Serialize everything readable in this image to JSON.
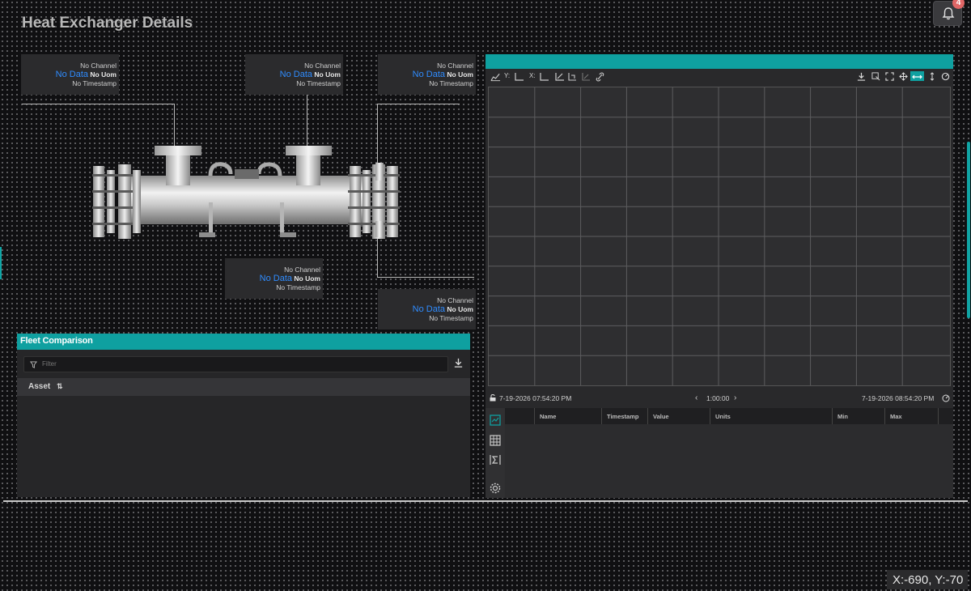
{
  "page": {
    "title": "Heat Exchanger Details"
  },
  "notifications": {
    "count": "4",
    "icon": "bell-icon"
  },
  "readouts": [
    {
      "channel": "No Channel",
      "value": "No Data",
      "uom": "No Uom",
      "timestamp": "No Timestamp"
    },
    {
      "channel": "No Channel",
      "value": "No Data",
      "uom": "No Uom",
      "timestamp": "No Timestamp"
    },
    {
      "channel": "No Channel",
      "value": "No Data",
      "uom": "No Uom",
      "timestamp": "No Timestamp"
    },
    {
      "channel": "No Channel",
      "value": "No Data",
      "uom": "No Uom",
      "timestamp": "No Timestamp"
    },
    {
      "channel": "No Channel",
      "value": "No Data",
      "uom": "No Uom",
      "timestamp": "No Timestamp"
    }
  ],
  "fleet": {
    "title": "Fleet Comparison",
    "filter_placeholder": "Filter",
    "column_asset": "Asset"
  },
  "trend": {
    "toolbar": {
      "y_label": "Y:",
      "x_label": "X:"
    },
    "time": {
      "start": "7-19-2026 07:54:20 PM",
      "window": "1:00:00",
      "end": "7-19-2026 08:54:20 PM"
    },
    "columns": [
      "Name",
      "Timestamp",
      "Value",
      "Units",
      "Min",
      "Max"
    ]
  },
  "coords": "X:-690, Y:-70",
  "colors": {
    "accent": "#0fa0a0",
    "value_blue": "#2f8cff",
    "badge": "#e06666"
  }
}
